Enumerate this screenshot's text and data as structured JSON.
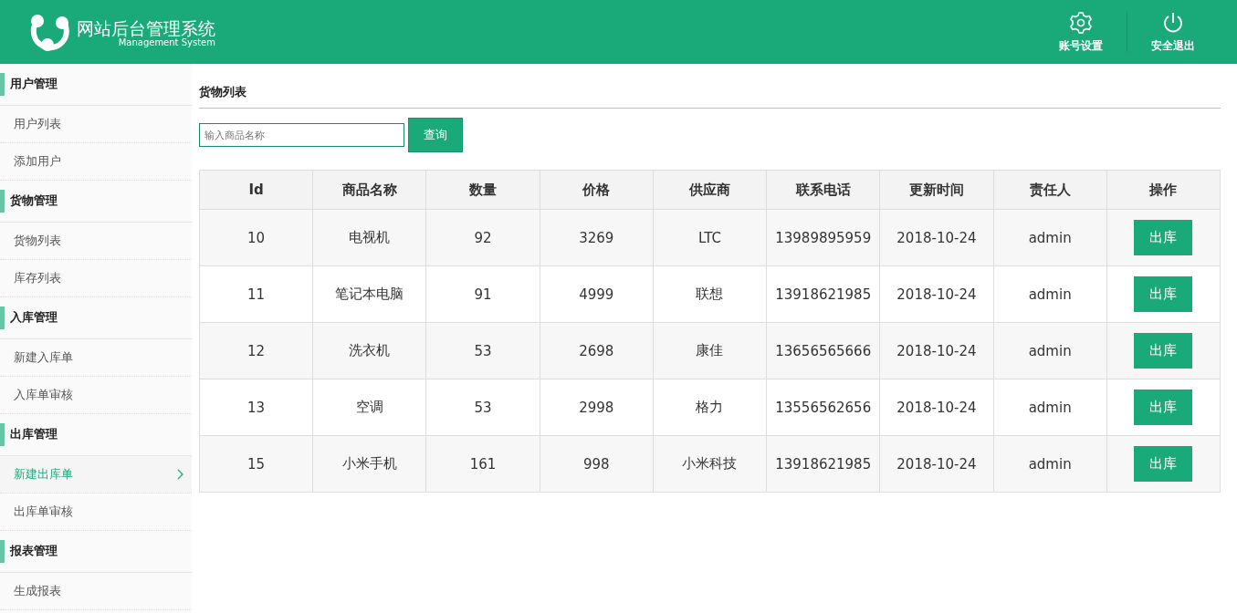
{
  "header": {
    "title": "网站后台管理系统",
    "subtitle": "Management System",
    "actions": [
      {
        "kind": "settings",
        "label": "账号设置"
      },
      {
        "kind": "power",
        "label": "安全退出"
      }
    ]
  },
  "sidebar": {
    "groups": [
      {
        "title": "用户管理",
        "items": [
          {
            "label": "用户列表",
            "selected": false
          },
          {
            "label": "添加用户",
            "selected": false
          }
        ]
      },
      {
        "title": "货物管理",
        "items": [
          {
            "label": "货物列表",
            "selected": false
          },
          {
            "label": "库存列表",
            "selected": false
          }
        ]
      },
      {
        "title": "入库管理",
        "items": [
          {
            "label": "新建入库单",
            "selected": false
          },
          {
            "label": "入库单审核",
            "selected": false
          }
        ]
      },
      {
        "title": "出库管理",
        "items": [
          {
            "label": "新建出库单",
            "selected": true
          },
          {
            "label": "出库单审核",
            "selected": false
          }
        ]
      },
      {
        "title": "报表管理",
        "items": [
          {
            "label": "生成报表",
            "selected": false
          }
        ]
      }
    ]
  },
  "content": {
    "title": "货物列表",
    "search": {
      "placeholder": "输入商品名称",
      "button": "查询"
    },
    "table": {
      "columns": [
        "Id",
        "商品名称",
        "数量",
        "价格",
        "供应商",
        "联系电话",
        "更新时间",
        "责任人",
        "操作"
      ],
      "rows": [
        {
          "cells": [
            "10",
            "电视机",
            "92",
            "3269",
            "LTC",
            "13989895959",
            "2018-10-24",
            "admin"
          ],
          "action": "出库"
        },
        {
          "cells": [
            "11",
            "笔记本电脑",
            "91",
            "4999",
            "联想",
            "13918621985",
            "2018-10-24",
            "admin"
          ],
          "action": "出库"
        },
        {
          "cells": [
            "12",
            "洗衣机",
            "53",
            "2698",
            "康佳",
            "13656565666",
            "2018-10-24",
            "admin"
          ],
          "action": "出库"
        },
        {
          "cells": [
            "13",
            "空调",
            "53",
            "2998",
            "格力",
            "13556562656",
            "2018-10-24",
            "admin"
          ],
          "action": "出库"
        },
        {
          "cells": [
            "15",
            "小米手机",
            "161",
            "998",
            "小米科技",
            "13918621985",
            "2018-10-24",
            "admin"
          ],
          "action": "出库"
        }
      ]
    }
  }
}
